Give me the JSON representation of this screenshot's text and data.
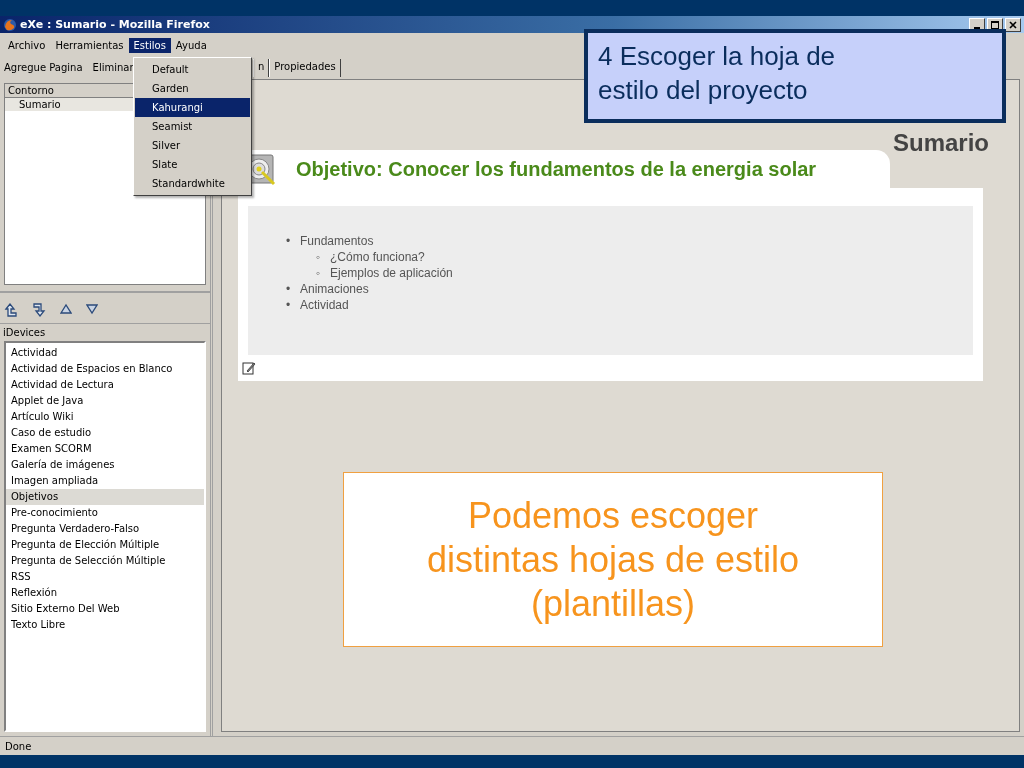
{
  "window": {
    "title": "eXe : Sumario - Mozilla Firefox"
  },
  "menu_bar": [
    {
      "label": "Archivo",
      "selected": false
    },
    {
      "label": "Herramientas",
      "selected": false
    },
    {
      "label": "Estilos",
      "selected": true
    },
    {
      "label": "Ayuda",
      "selected": false
    }
  ],
  "styles_menu": [
    {
      "label": "Default",
      "selected": false
    },
    {
      "label": "Garden",
      "selected": false
    },
    {
      "label": "Kahurangi",
      "selected": true
    },
    {
      "label": "Seamist",
      "selected": false
    },
    {
      "label": "Silver",
      "selected": false
    },
    {
      "label": "Slate",
      "selected": false
    },
    {
      "label": "Standardwhite",
      "selected": false
    }
  ],
  "toolbar": [
    "Agregue Pagina",
    "Eliminar"
  ],
  "outline": {
    "header": "Contorno",
    "items": [
      "Sumario"
    ]
  },
  "idevices": {
    "label": "iDevices",
    "items": [
      {
        "label": "Actividad",
        "selected": false
      },
      {
        "label": "Actividad de Espacios en Blanco",
        "selected": false
      },
      {
        "label": "Actividad de Lectura",
        "selected": false
      },
      {
        "label": "Applet de Java",
        "selected": false
      },
      {
        "label": "Artículo Wiki",
        "selected": false
      },
      {
        "label": "Caso de estudio",
        "selected": false
      },
      {
        "label": "Examen SCORM",
        "selected": false
      },
      {
        "label": "Galería de imágenes",
        "selected": false
      },
      {
        "label": "Imagen ampliada",
        "selected": false
      },
      {
        "label": "Objetivos",
        "selected": true
      },
      {
        "label": "Pre-conocimiento",
        "selected": false
      },
      {
        "label": "Pregunta Verdadero-Falso",
        "selected": false
      },
      {
        "label": "Pregunta de Elección Múltiple",
        "selected": false
      },
      {
        "label": "Pregunta de Selección Múltiple",
        "selected": false
      },
      {
        "label": "RSS",
        "selected": false
      },
      {
        "label": "Reflexión",
        "selected": false
      },
      {
        "label": "Sitio Externo Del Web",
        "selected": false
      },
      {
        "label": "Texto Libre",
        "selected": false
      }
    ]
  },
  "tabs": [
    {
      "label": "n",
      "selected": false
    },
    {
      "label": "Propiedades",
      "selected": false
    }
  ],
  "page": {
    "heading": "Sumario",
    "idevice_title": "Objetivo: Conocer los fundamentos de la energia solar",
    "list": [
      {
        "marker": "•",
        "text": "Fundamentos",
        "children": [
          {
            "marker": "◦",
            "text": "¿Cómo funciona?"
          },
          {
            "marker": "◦",
            "text": "Ejemplos de aplicación"
          }
        ]
      },
      {
        "marker": "•",
        "text": "Animaciones"
      },
      {
        "marker": "•",
        "text": "Actividad"
      }
    ]
  },
  "status_bar": "Done",
  "callouts": [
    {
      "kind": "step",
      "text": "4 Escoger la hoja de estilo del proyecto"
    },
    {
      "kind": "note",
      "text": "Podemos escoger distintas hojas de estilo (plantillas)"
    }
  ]
}
